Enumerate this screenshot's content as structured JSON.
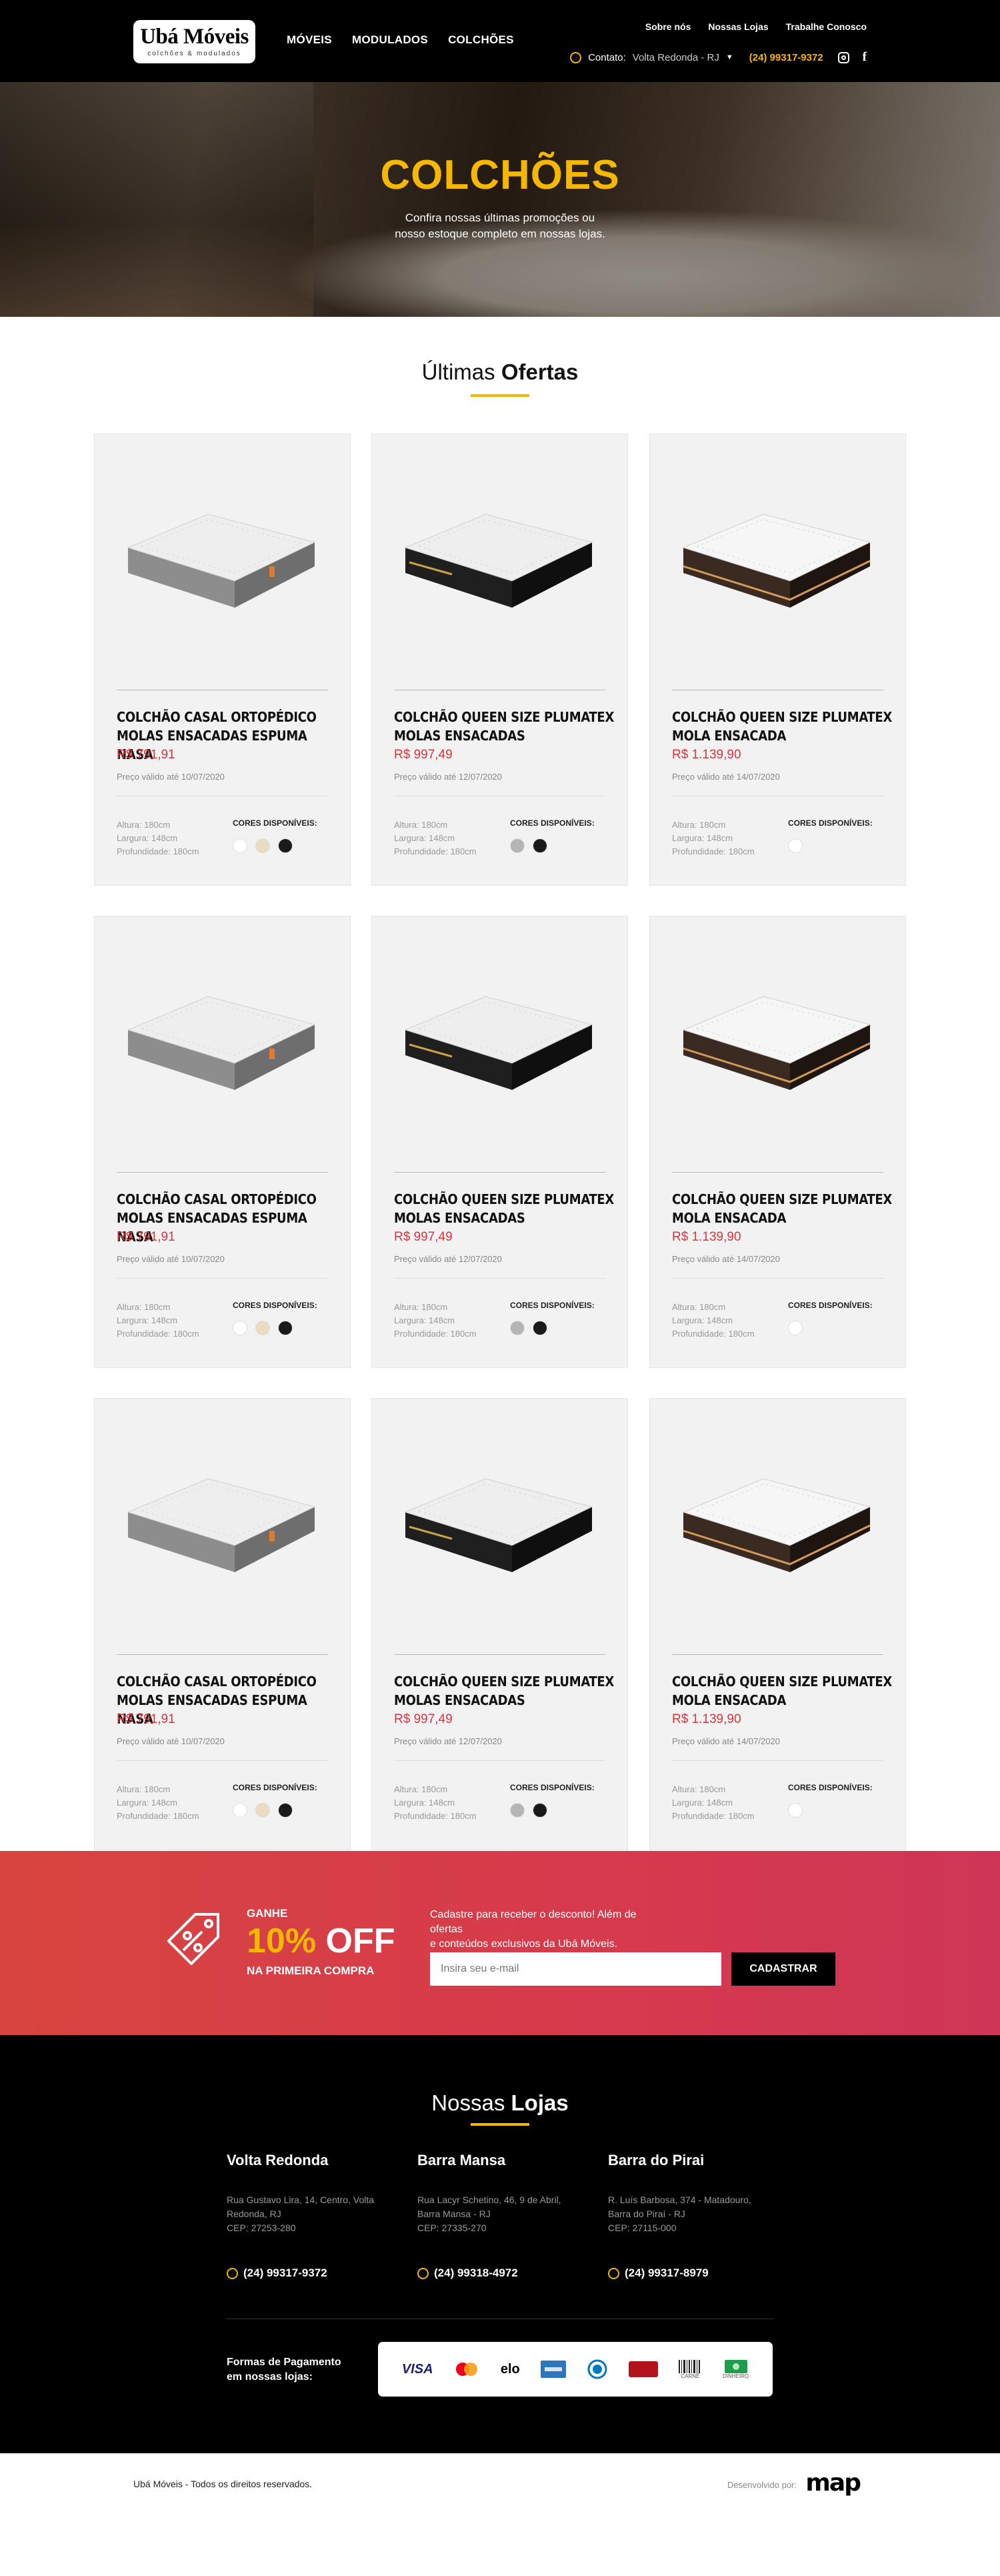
{
  "header": {
    "logo_title": "Ubá Móveis",
    "logo_subtitle": "colchões & modulados",
    "main_nav": [
      "MÓVEIS",
      "MODULADOS",
      "COLCHÕES"
    ],
    "top_nav": [
      "Sobre nós",
      "Nossas Lojas",
      "Trabalhe Conosco"
    ],
    "contact_label": "Contato:",
    "location": "Volta Redonda - RJ",
    "phone": "(24) 99317-9372"
  },
  "hero": {
    "title": "COLCHÕES",
    "subtitle_line1": "Confira nossas últimas promoções ou",
    "subtitle_line2": "nosso estoque completo em nossas lojas."
  },
  "offers": {
    "title_light": "Últimas",
    "title_bold": "Ofertas"
  },
  "products": [
    {
      "name": "COLCHÃO CASAL ORTOPÉDICO MOLAS ENSACADAS ESPUMA NASA",
      "price": "R$ 791,91",
      "valid": "Preço válido até 10/07/2020",
      "height": "Altura: 180cm",
      "width": "Largura: 148cm",
      "depth": "Profundidade: 180cm",
      "colors_label": "CORES DISPONÍVEIS:",
      "colors": [
        "#ffffff",
        "#e9dcc0",
        "#1a1a1a"
      ],
      "style": "gray"
    },
    {
      "name": "COLCHÃO QUEEN SIZE PLUMATEX MOLAS ENSACADAS",
      "price": "R$ 997,49",
      "valid": "Preço válido até 12/07/2020",
      "height": "Altura: 180cm",
      "width": "Largura: 148cm",
      "depth": "Profundidade: 180cm",
      "colors_label": "CORES DISPONÍVEIS:",
      "colors": [
        "#b5b5b5",
        "#1a1a1a"
      ],
      "style": "black"
    },
    {
      "name": "COLCHÃO QUEEN SIZE PLUMATEX MOLA ENSACADA",
      "price": "R$ 1.139,90",
      "valid": "Preço válido até 14/07/2020",
      "height": "Altura: 180cm",
      "width": "Largura: 148cm",
      "depth": "Profundidade: 180cm",
      "colors_label": "CORES DISPONÍVEIS:",
      "colors": [
        "#ffffff"
      ],
      "style": "brown"
    },
    {
      "name": "COLCHÃO CASAL ORTOPÉDICO MOLAS ENSACADAS ESPUMA NASA",
      "price": "R$ 791,91",
      "valid": "Preço válido até 10/07/2020",
      "height": "Altura: 180cm",
      "width": "Largura: 148cm",
      "depth": "Profundidade: 180cm",
      "colors_label": "CORES DISPONÍVEIS:",
      "colors": [
        "#ffffff",
        "#e9dcc0",
        "#1a1a1a"
      ],
      "style": "gray"
    },
    {
      "name": "COLCHÃO QUEEN SIZE PLUMATEX MOLAS ENSACADAS",
      "price": "R$ 997,49",
      "valid": "Preço válido até 12/07/2020",
      "height": "Altura: 180cm",
      "width": "Largura: 148cm",
      "depth": "Profundidade: 180cm",
      "colors_label": "CORES DISPONÍVEIS:",
      "colors": [
        "#b5b5b5",
        "#1a1a1a"
      ],
      "style": "black"
    },
    {
      "name": "COLCHÃO QUEEN SIZE PLUMATEX MOLA ENSACADA",
      "price": "R$ 1.139,90",
      "valid": "Preço válido até 14/07/2020",
      "height": "Altura: 180cm",
      "width": "Largura: 148cm",
      "depth": "Profundidade: 180cm",
      "colors_label": "CORES DISPONÍVEIS:",
      "colors": [
        "#ffffff"
      ],
      "style": "brown"
    },
    {
      "name": "COLCHÃO CASAL ORTOPÉDICO MOLAS ENSACADAS ESPUMA NASA",
      "price": "R$ 791,91",
      "valid": "Preço válido até 10/07/2020",
      "height": "Altura: 180cm",
      "width": "Largura: 148cm",
      "depth": "Profundidade: 180cm",
      "colors_label": "CORES DISPONÍVEIS:",
      "colors": [
        "#ffffff",
        "#e9dcc0",
        "#1a1a1a"
      ],
      "style": "gray"
    },
    {
      "name": "COLCHÃO QUEEN SIZE PLUMATEX MOLAS ENSACADAS",
      "price": "R$ 997,49",
      "valid": "Preço válido até 12/07/2020",
      "height": "Altura: 180cm",
      "width": "Largura: 148cm",
      "depth": "Profundidade: 180cm",
      "colors_label": "CORES DISPONÍVEIS:",
      "colors": [
        "#b5b5b5",
        "#1a1a1a"
      ],
      "style": "black"
    },
    {
      "name": "COLCHÃO QUEEN SIZE PLUMATEX MOLA ENSACADA",
      "price": "R$ 1.139,90",
      "valid": "Preço válido até 14/07/2020",
      "height": "Altura: 180cm",
      "width": "Largura: 148cm",
      "depth": "Profundidade: 180cm",
      "colors_label": "CORES DISPONÍVEIS:",
      "colors": [
        "#ffffff"
      ],
      "style": "brown"
    }
  ],
  "cta": {
    "ganhe": "GANHE",
    "percent": "10%",
    "off": "OFF",
    "primeira": "NA PRIMEIRA COMPRA",
    "text_line1": "Cadastre para receber o desconto! Além de ofertas",
    "text_line2": "e conteúdos exclusivos da Ubá Móveis.",
    "email_placeholder": "Insira seu e-mail",
    "button": "CADASTRAR"
  },
  "stores": {
    "title_light": "Nossas",
    "title_bold": "Lojas",
    "list": [
      {
        "name": "Volta Redonda",
        "addr1": "Rua Gustavo Lira, 14, Centro, Volta",
        "addr2": "Redonda, RJ",
        "addr3": "CEP: 27253-280",
        "phone": "(24) 99317-9372"
      },
      {
        "name": "Barra Mansa",
        "addr1": "Rua Lacyr Schetino, 46, 9 de Abril,",
        "addr2": "Barra Mansa - RJ",
        "addr3": "CEP: 27335-270",
        "phone": "(24) 99318-4972"
      },
      {
        "name": "Barra do Pirai",
        "addr1": "R. Luís Barbosa, 374 - Matadouro,",
        "addr2": "Barra do Piraí - RJ",
        "addr3": "CEP: 27115-000",
        "phone": "(24) 99317-8979"
      }
    ],
    "payment_line1": "Formas de Pagamento",
    "payment_line2": "em nossas lojas:",
    "payment_methods": [
      "VISA",
      "mastercard",
      "elo",
      "amex",
      "diners",
      "hipercard",
      "CARNÊ",
      "DINHEIRO"
    ]
  },
  "footer": {
    "copyright": "Ubá Móveis - Todos os direitos reservados.",
    "developed_by": "Desenvolvido por:",
    "dev_logo": "map"
  }
}
